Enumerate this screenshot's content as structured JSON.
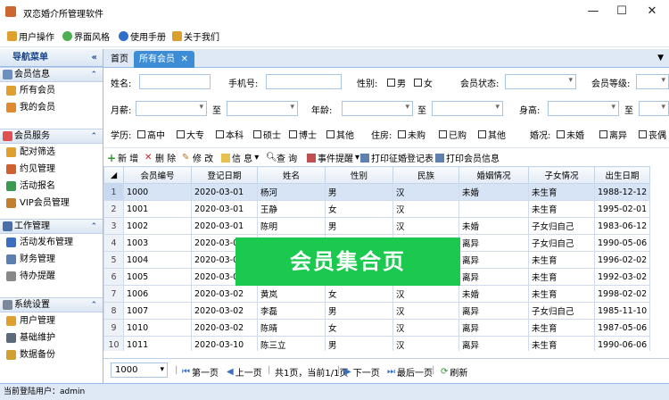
{
  "window": {
    "title": "双恋婚介所管理软件",
    "controls": [
      "—",
      "☐",
      "✕"
    ]
  },
  "menu": [
    {
      "label": "用户操作",
      "icon": "users-icon"
    },
    {
      "label": "界面风格",
      "icon": "palette-icon"
    },
    {
      "label": "使用手册",
      "icon": "help-icon"
    },
    {
      "label": "关于我们",
      "icon": "about-icon"
    }
  ],
  "sidebar": {
    "title": "导航菜单",
    "collapse": "«",
    "groups": [
      {
        "title": "会员信息",
        "items": [
          "所有会员",
          "我的会员"
        ]
      },
      {
        "title": "会员服务",
        "items": [
          "配对筛选",
          "约见管理",
          "活动报名",
          "VIP会员管理"
        ]
      },
      {
        "title": "工作管理",
        "items": [
          "活动发布管理",
          "财务管理",
          "待办提醒"
        ]
      },
      {
        "title": "系统设置",
        "items": [
          "用户管理",
          "基础维护",
          "数据备份"
        ]
      }
    ],
    "arrow": "⌃"
  },
  "tabs": {
    "home": "首页",
    "active": "所有会员",
    "close": "✕",
    "menu": "▼"
  },
  "filters": {
    "name": "姓名:",
    "phone": "手机号:",
    "gender": "性别:",
    "male": "男",
    "female": "女",
    "member_status": "会员状态:",
    "member_level": "会员等级:",
    "income": "月薪:",
    "to": "至",
    "age": "年龄:",
    "height": "身高:",
    "education": "学历:",
    "edu_options": [
      "高中",
      "大专",
      "本科",
      "硕士",
      "博士",
      "其他"
    ],
    "housing": "住房:",
    "housing_options": [
      "未购",
      "已购",
      "其他"
    ],
    "marriage": "婚况:",
    "marriage_options": [
      "未婚",
      "离异",
      "丧偶"
    ]
  },
  "toolbar": [
    "新 增",
    "删 除",
    "修 改",
    "信 息",
    "查 询",
    "事件提醒",
    "打印征婚登记表",
    "打印会员信息"
  ],
  "grid": {
    "columns": [
      "会员编号",
      "登记日期",
      "姓名",
      "性别",
      "民族",
      "婚姻情况",
      "子女情况",
      "出生日期"
    ],
    "rows": [
      [
        "1",
        "1000",
        "2020-03-01",
        "杨河",
        "男",
        "汉",
        "未婚",
        "未生育",
        "1988-12-12"
      ],
      [
        "2",
        "1001",
        "2020-03-01",
        "王静",
        "女",
        "汉",
        "",
        "未生育",
        "1995-02-01"
      ],
      [
        "3",
        "1002",
        "2020-03-01",
        "陈明",
        "男",
        "汉",
        "未婚",
        "子女归自己",
        "1983-06-12"
      ],
      [
        "4",
        "1003",
        "2020-03-02",
        "",
        "",
        "",
        "离异",
        "子女归自己",
        "1990-05-06"
      ],
      [
        "5",
        "1004",
        "2020-03-02",
        "",
        "",
        "",
        "离异",
        "未生育",
        "1996-02-02"
      ],
      [
        "6",
        "1005",
        "2020-03-02",
        "",
        "",
        "",
        "离异",
        "未生育",
        "1992-03-02"
      ],
      [
        "7",
        "1006",
        "2020-03-02",
        "黄岚",
        "女",
        "汉",
        "未婚",
        "未生育",
        "1998-02-02"
      ],
      [
        "8",
        "1007",
        "2020-03-02",
        "李磊",
        "男",
        "汉",
        "离异",
        "子女归自己",
        "1985-11-10"
      ],
      [
        "9",
        "1010",
        "2020-03-02",
        "陈晴",
        "女",
        "汉",
        "离异",
        "未生育",
        "1987-05-06"
      ],
      [
        "10",
        "1011",
        "2020-03-10",
        "陈三立",
        "男",
        "汉",
        "离异",
        "未生育",
        "1990-06-06"
      ]
    ]
  },
  "pager": {
    "page_size": "1000",
    "first": "第一页",
    "prev": "上一页",
    "info": "共1页，当前1/1页",
    "next": "下一页",
    "last": "最后一页",
    "refresh": "刷新"
  },
  "status": "当前登陆用户：admin",
  "overlay": "会员集合页"
}
